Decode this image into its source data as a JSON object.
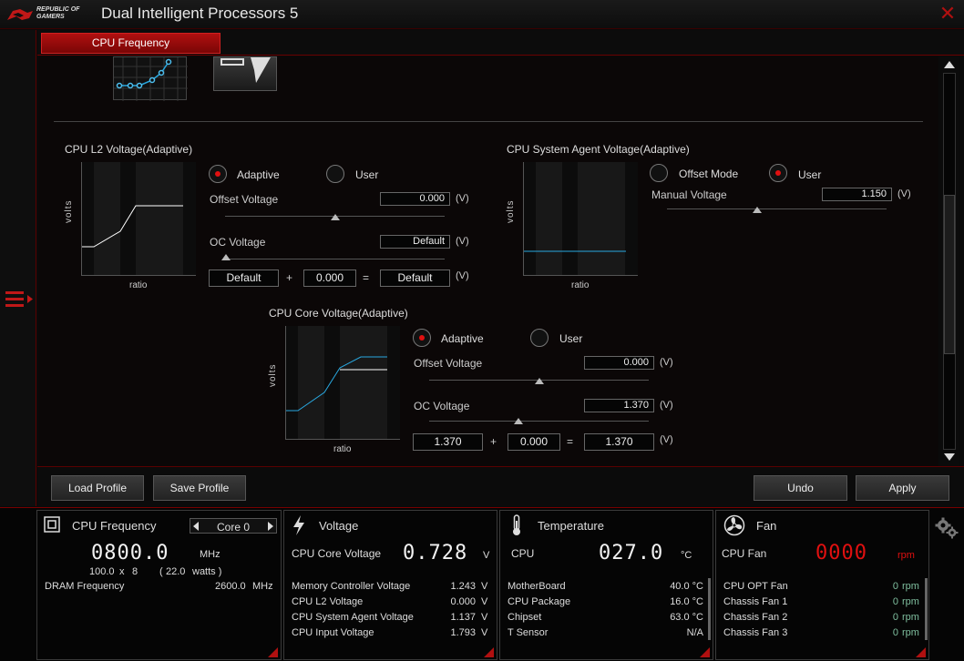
{
  "app": {
    "title": "Dual Intelligent Processors 5",
    "logo_line1": "REPUBLIC OF",
    "logo_line2": "GAMERS"
  },
  "tab": {
    "label": "CPU Frequency"
  },
  "l2": {
    "title": "CPU L2 Voltage(Adaptive)",
    "y_label": "volts",
    "x_label": "ratio",
    "mode_adaptive": "Adaptive",
    "mode_user": "User",
    "selected": "Adaptive",
    "offset_label": "Offset Voltage",
    "offset_value": "0.000",
    "unit": "(V)",
    "oc_label": "OC Voltage",
    "oc_value": "Default",
    "sum_a": "Default",
    "sum_b": "0.000",
    "sum_result": "Default",
    "plus": "+",
    "equals": "="
  },
  "sa": {
    "title": "CPU System Agent Voltage(Adaptive)",
    "y_label": "volts",
    "x_label": "ratio",
    "mode_offset": "Offset Mode",
    "mode_user": "User",
    "selected": "User",
    "manual_label": "Manual Voltage",
    "manual_value": "1.150",
    "unit": "(V)"
  },
  "core": {
    "title": "CPU Core Voltage(Adaptive)",
    "y_label": "volts",
    "x_label": "ratio",
    "mode_adaptive": "Adaptive",
    "mode_user": "User",
    "selected": "Adaptive",
    "offset_label": "Offset Voltage",
    "offset_value": "0.000",
    "unit": "(V)",
    "oc_label": "OC Voltage",
    "oc_value": "1.370",
    "sum_a": "1.370",
    "sum_b": "0.000",
    "sum_result": "1.370",
    "plus": "+",
    "equals": "="
  },
  "buttons": {
    "load": "Load Profile",
    "save": "Save Profile",
    "undo": "Undo",
    "apply": "Apply"
  },
  "freq": {
    "title": "CPU Frequency",
    "core_select": "Core 0",
    "value": "0800.0",
    "unit": "MHz",
    "bclk": "100.0",
    "times": "x",
    "multiplier": "8",
    "watts_open": "(",
    "watts": "22.0",
    "watts_unit": "watts )",
    "dram_label": "DRAM Frequency",
    "dram_value": "2600.0",
    "dram_unit": "MHz"
  },
  "voltage": {
    "title": "Voltage",
    "main_label": "CPU Core Voltage",
    "main_value": "0.728",
    "main_unit": "V",
    "rows": [
      {
        "label": "Memory Controller Voltage",
        "value": "1.243",
        "unit": "V"
      },
      {
        "label": "CPU L2 Voltage",
        "value": "0.000",
        "unit": "V"
      },
      {
        "label": "CPU System Agent Voltage",
        "value": "1.137",
        "unit": "V"
      },
      {
        "label": "CPU Input Voltage",
        "value": "1.793",
        "unit": "V"
      }
    ]
  },
  "temp": {
    "title": "Temperature",
    "main_label": "CPU",
    "main_value": "027.0",
    "main_unit": "°C",
    "rows": [
      {
        "label": "MotherBoard",
        "value": "40.0 °C"
      },
      {
        "label": "CPU Package",
        "value": "16.0 °C"
      },
      {
        "label": "Chipset",
        "value": "63.0 °C"
      },
      {
        "label": "T Sensor",
        "value": "N/A"
      }
    ]
  },
  "fan": {
    "title": "Fan",
    "main_label": "CPU Fan",
    "main_value": "0000",
    "main_unit": "rpm",
    "rows": [
      {
        "label": "CPU OPT Fan",
        "value": "0",
        "unit": "rpm"
      },
      {
        "label": "Chassis Fan 1",
        "value": "0",
        "unit": "rpm"
      },
      {
        "label": "Chassis Fan 2",
        "value": "0",
        "unit": "rpm"
      },
      {
        "label": "Chassis Fan 3",
        "value": "0",
        "unit": "rpm"
      }
    ]
  },
  "colors": {
    "accent": "#b01010",
    "curve_blue": "#29a8e0",
    "curve_white": "#ffffff"
  }
}
